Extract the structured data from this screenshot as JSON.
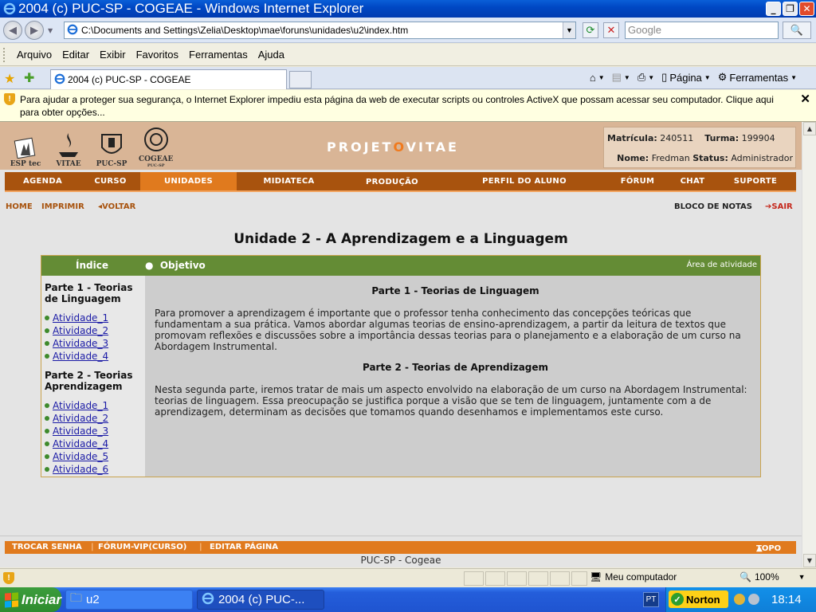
{
  "window": {
    "title": "2004 (c) PUC-SP - COGEAE - Windows Internet Explorer"
  },
  "address": {
    "url": "C:\\Documents and Settings\\Zelia\\Desktop\\mae\\foruns\\unidades\\u2\\index.htm",
    "search_placeholder": "Google"
  },
  "menu": [
    "Arquivo",
    "Editar",
    "Exibir",
    "Favoritos",
    "Ferramentas",
    "Ajuda"
  ],
  "tab": {
    "label": "2004 (c) PUC-SP - COGEAE"
  },
  "commands": {
    "page": "Página",
    "tools": "Ferramentas"
  },
  "infobar": {
    "text": "Para ajudar a proteger sua segurança, o Internet Explorer impediu esta página da web de executar scripts ou controles ActiveX que possam acessar seu computador. Clique aqui para obter opções..."
  },
  "site": {
    "logos": {
      "esp": "ESP tec",
      "vitae": "VITAE",
      "pucsp": "PUC-SP",
      "cogeae": "COGEAE",
      "cogeae_sub": "PUC-SP"
    },
    "brand_pre": "PROJET",
    "brand_o": "O",
    "brand_post": "VITAE",
    "user": {
      "matricula_label": "Matrícula:",
      "matricula": "240511",
      "turma_label": "Turma:",
      "turma": "199904",
      "nome_label": "Nome:",
      "nome": "Fredman",
      "status_label": "Status:",
      "status": "Administrador"
    },
    "nav": [
      "AGENDA",
      "CURSO",
      "UNIDADES",
      "MIDIATECA",
      "PRODUÇÃO",
      "PERFIL DO ALUNO",
      "FÓRUM",
      "CHAT",
      "SUPORTE"
    ],
    "subnav": {
      "home": "HOME",
      "print": "IMPRIMIR",
      "back": "VOLTAR",
      "notes": "BLOCO DE NOTAS",
      "exit": "SAIR"
    },
    "page_title": "Unidade 2 - A Aprendizagem e a Linguagem",
    "box": {
      "index": "Índice",
      "objective": "Objetivo",
      "area": "Área de atividade"
    },
    "sidebar": {
      "part1": "Parte 1 - Teorias de Linguagem",
      "part1_items": [
        "Atividade_1",
        "Atividade_2",
        "Atividade_3",
        "Atividade_4"
      ],
      "part2": "Parte 2 - Teorias Aprendizagem",
      "part2_items": [
        "Atividade_1",
        "Atividade_2",
        "Atividade_3",
        "Atividade_4",
        "Atividade_5",
        "Atividade_6"
      ]
    },
    "main": {
      "h1": "Parte 1 - Teorias de Linguagem",
      "p1": "Para promover a aprendizagem é importante que o professor tenha conhecimento das concepções teóricas que fundamentam a sua prática. Vamos abordar algumas teorias de ensino-aprendizagem, a partir da leitura de textos que promovam reflexões e discussões sobre a importância dessas teorias para o planejamento e a elaboração de um curso na Abordagem Instrumental.",
      "h2": "Parte 2 - Teorias de Aprendizagem",
      "p2": "Nesta segunda parte, iremos tratar de mais um aspecto envolvido na elaboração de um curso na Abordagem Instrumental: teorias de linguagem. Essa preocupação se justifica porque a visão que se tem de linguagem, juntamente com a de aprendizagem, determinam as decisões que tomamos quando desenhamos e implementamos este curso."
    },
    "footer": {
      "trocar": "TROCAR SENHA",
      "forum": "FÓRUM-VIP(CURSO)",
      "editar": "EDITAR PÁGINA",
      "top": "TOPO",
      "text": "PUC-SP - Cogeae"
    }
  },
  "status": {
    "zone": "Meu computador",
    "zoom": "100%"
  },
  "taskbar": {
    "start": "Iniciar",
    "u2": "u2",
    "ie": "2004 (c) PUC-...",
    "lang": "PT",
    "norton": "Norton",
    "clock": "18:14"
  }
}
